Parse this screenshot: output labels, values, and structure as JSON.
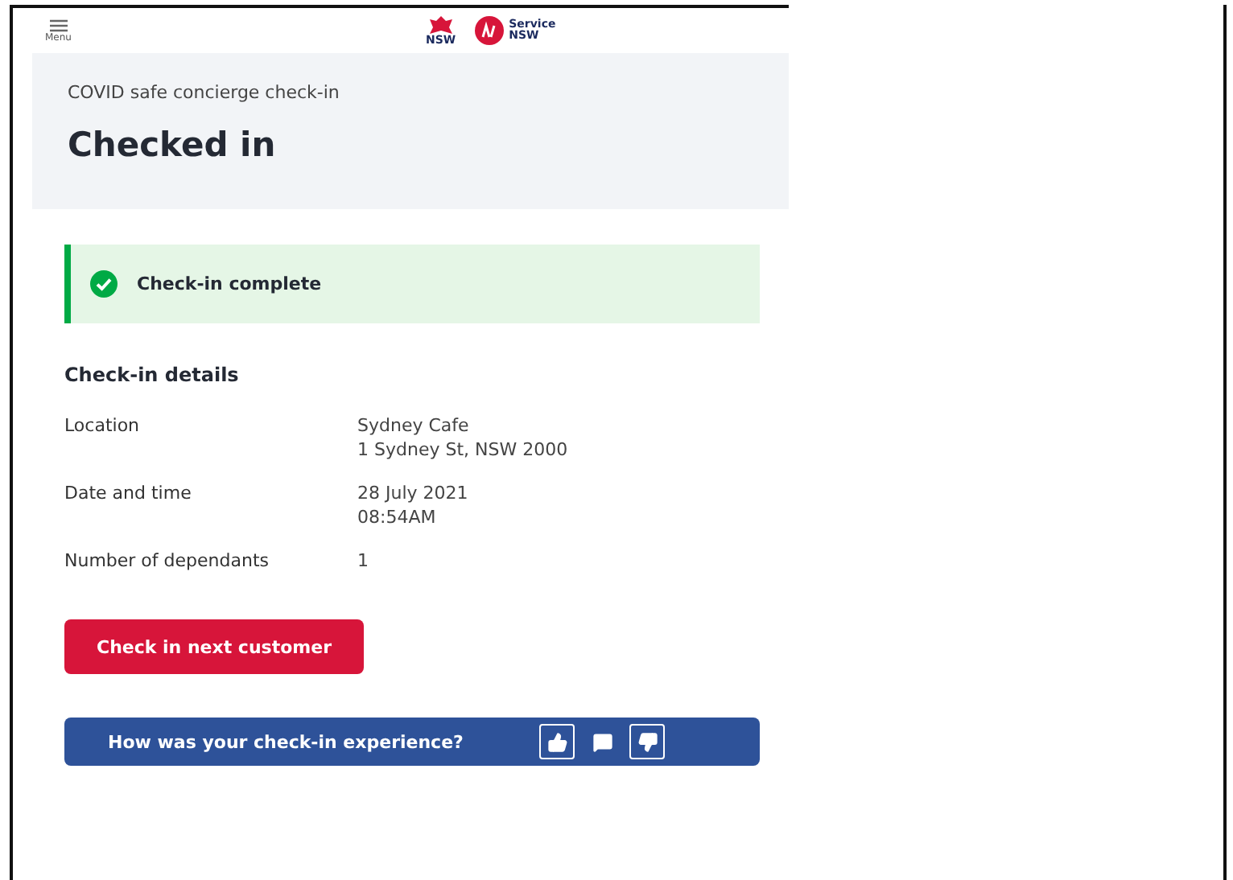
{
  "header": {
    "menu_label": "Menu",
    "logos": [
      {
        "kind": "waratah",
        "text": "NSW"
      },
      {
        "kind": "service",
        "text": "Service\nNSW"
      }
    ]
  },
  "banner": {
    "subtitle": "COVID safe concierge check-in",
    "title": "Checked in"
  },
  "alert": {
    "kind": "success",
    "text": "Check-in complete"
  },
  "details": {
    "heading": "Check-in details",
    "rows": [
      {
        "label": "Location",
        "values": [
          "Sydney Cafe",
          "1 Sydney St, NSW 2000"
        ]
      },
      {
        "label": "Date and time",
        "values": [
          "28 July 2021",
          "08:54AM"
        ]
      },
      {
        "label": "Number of dependants",
        "values": [
          "1"
        ]
      }
    ]
  },
  "primary_button": "Check in next customer",
  "feedback": {
    "question": "How was your check-in experience?",
    "actions": [
      {
        "kind": "thumbs_up"
      },
      {
        "kind": "comment"
      },
      {
        "kind": "thumbs_down"
      }
    ]
  }
}
